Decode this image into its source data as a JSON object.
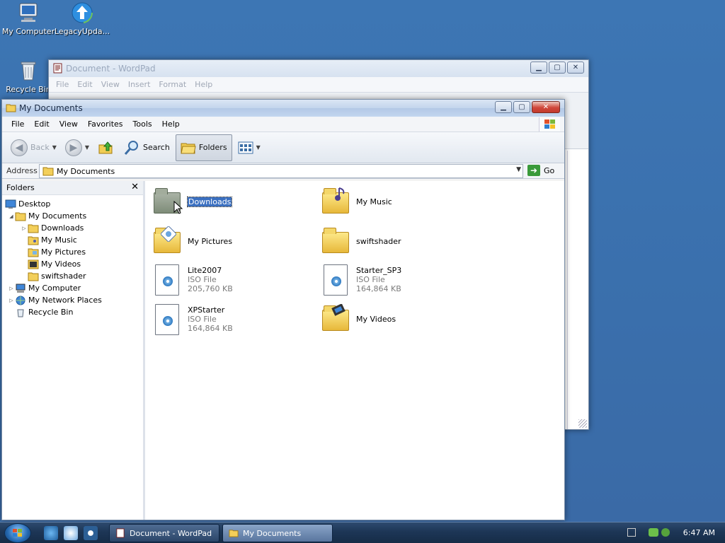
{
  "desktop": {
    "icons": [
      {
        "label": "My Computer"
      },
      {
        "label": "LegacyUpda..."
      },
      {
        "label": "Recycle Bin"
      }
    ]
  },
  "wordpad": {
    "title": "Document - WordPad",
    "menu": [
      "File",
      "Edit",
      "View",
      "Insert",
      "Format",
      "Help"
    ]
  },
  "explorer": {
    "title": "My Documents",
    "menu": [
      "File",
      "Edit",
      "View",
      "Favorites",
      "Tools",
      "Help"
    ],
    "toolbar": {
      "back": "Back",
      "search": "Search",
      "folders": "Folders"
    },
    "address": {
      "label": "Address",
      "value": "My Documents",
      "go": "Go"
    },
    "folders_pane": {
      "title": "Folders",
      "tree": [
        {
          "label": "Desktop"
        },
        {
          "label": "My Documents"
        },
        {
          "label": "Downloads"
        },
        {
          "label": "My Music"
        },
        {
          "label": "My Pictures"
        },
        {
          "label": "My Videos"
        },
        {
          "label": "swiftshader"
        },
        {
          "label": "My Computer"
        },
        {
          "label": "My Network Places"
        },
        {
          "label": "Recycle Bin"
        }
      ]
    },
    "files": [
      {
        "name": "Downloads"
      },
      {
        "name": "My Music"
      },
      {
        "name": "My Pictures"
      },
      {
        "name": "swiftshader"
      },
      {
        "name": "Lite2007",
        "type": "ISO File",
        "size": "205,760 KB"
      },
      {
        "name": "Starter_SP3",
        "type": "ISO File",
        "size": "164,864 KB"
      },
      {
        "name": "XPStarter",
        "type": "ISO File",
        "size": "164,864 KB"
      },
      {
        "name": "My Videos"
      }
    ]
  },
  "taskbar": {
    "tasks": [
      {
        "label": "Document - WordPad"
      },
      {
        "label": "My Documents"
      }
    ],
    "clock": "6:47 AM"
  },
  "colors": {
    "desktop": "#3a6ea5",
    "selection": "#3a6fc0",
    "taskbar": "#1d3656"
  }
}
